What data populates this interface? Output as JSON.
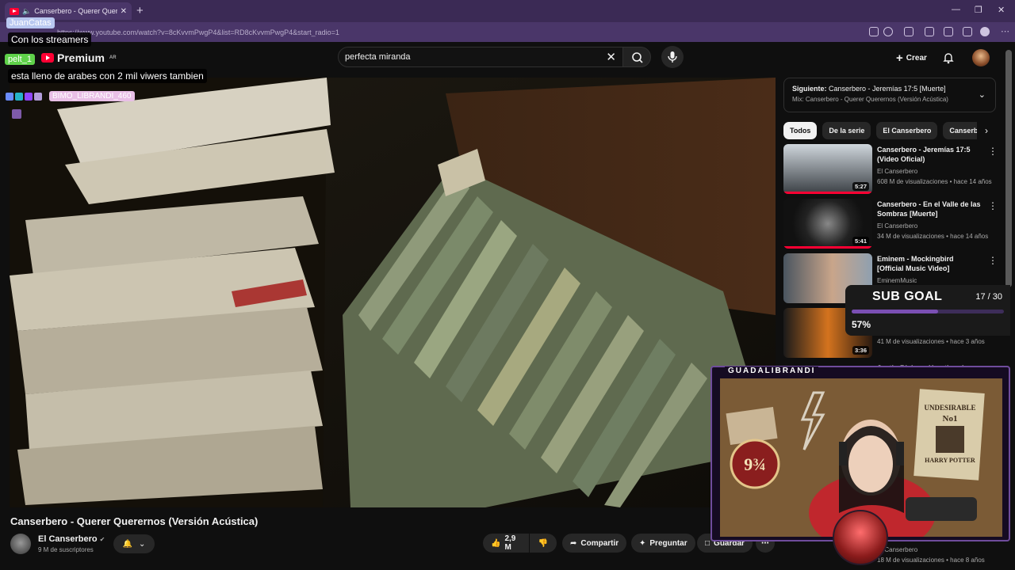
{
  "browser": {
    "tab_title": "Canserbero - Querer Querernos",
    "url": "https://www.youtube.com/watch?v=8cKvvmPwgP4&list=RD8cKvvmPwgP4&start_radio=1"
  },
  "youtube": {
    "logo_text": "Premium",
    "logo_region": "AR",
    "search_value": "perfecta miranda",
    "create_label": "Crear"
  },
  "video": {
    "title": "Canserbero - Querer Querernos (Versión Acústica)",
    "channel": "El Canserbero",
    "subscribers": "9 M de suscriptores",
    "likes": "2,9 M",
    "share_label": "Compartir",
    "ask_label": "Preguntar",
    "save_label": "Guardar"
  },
  "sidebar": {
    "up_next_prefix": "Siguiente:",
    "up_next_title": "Canserbero - Jeremías 17:5 [Muerte]",
    "mix_label": "Mix: Canserbero - Querer Querernos (Versión Acústica)",
    "chips": [
      "Todos",
      "De la serie",
      "El Canserbero",
      "Canserb"
    ],
    "videos": [
      {
        "title": "Canserbero - Jeremías 17:5 (Video Oficial)",
        "channel": "El Canserbero",
        "meta": "608 M de visualizaciones • hace 14 años",
        "duration": "5:27"
      },
      {
        "title": "Canserbero - En el Valle de las Sombras [Muerte]",
        "channel": "El Canserbero",
        "meta": "34 M de visualizaciones • hace 14 años",
        "duration": "5:41"
      },
      {
        "title": "Eminem - Mockingbird [Official Music Video]",
        "channel": "EminemMusic",
        "meta": "",
        "duration": ""
      },
      {
        "title": "",
        "channel": "",
        "meta": "41 M de visualizaciones • hace 3 años",
        "duration": "3:36"
      },
      {
        "title": "Justin Bieber - Heartbreaker",
        "channel": "",
        "meta": "",
        "duration": ""
      }
    ],
    "bottom_channel": "El Canserbero",
    "bottom_meta": "18 M de visualizaciones • hace 8 años"
  },
  "stream_overlay": {
    "chat": [
      {
        "name": "JuanCatas",
        "text": "Con los streamers"
      },
      {
        "name": "pelt_1",
        "text": "esta lleno de arabes con 2 mil viwers tambien"
      },
      {
        "name": "BIMO_LIBRANDI_460",
        "text": ""
      }
    ],
    "sub_goal_label": "SUB GOAL",
    "sub_goal_count": "17 / 30",
    "sub_goal_percent": "57%",
    "sub_goal_fraction": 0.57,
    "streamer_name": "GUADALIBRANDI"
  }
}
